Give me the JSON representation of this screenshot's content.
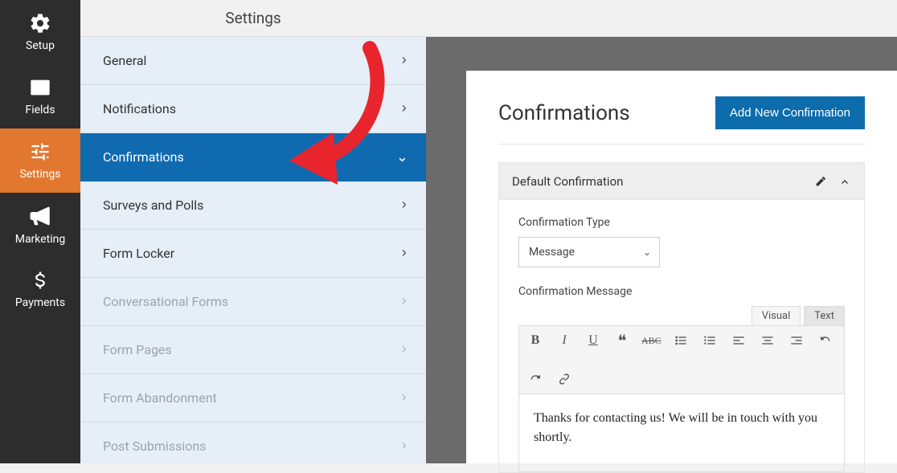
{
  "nav": {
    "items": [
      {
        "id": "setup",
        "label": "Setup"
      },
      {
        "id": "fields",
        "label": "Fields"
      },
      {
        "id": "settings",
        "label": "Settings"
      },
      {
        "id": "marketing",
        "label": "Marketing"
      },
      {
        "id": "payments",
        "label": "Payments"
      }
    ]
  },
  "settings_panel": {
    "title": "Settings",
    "items": [
      {
        "label": "General",
        "state": "normal"
      },
      {
        "label": "Notifications",
        "state": "normal"
      },
      {
        "label": "Confirmations",
        "state": "active"
      },
      {
        "label": "Surveys and Polls",
        "state": "normal"
      },
      {
        "label": "Form Locker",
        "state": "normal"
      },
      {
        "label": "Conversational Forms",
        "state": "disabled"
      },
      {
        "label": "Form Pages",
        "state": "disabled"
      },
      {
        "label": "Form Abandonment",
        "state": "disabled"
      },
      {
        "label": "Post Submissions",
        "state": "disabled"
      }
    ]
  },
  "confirmations": {
    "heading": "Confirmations",
    "add_button": "Add New Confirmation",
    "item_title": "Default Confirmation",
    "type_label": "Confirmation Type",
    "type_value": "Message",
    "message_label": "Confirmation Message",
    "editor_tabs": {
      "visual": "Visual",
      "text": "Text"
    },
    "message_body": "Thanks for contacting us! We will be in touch with you shortly."
  }
}
